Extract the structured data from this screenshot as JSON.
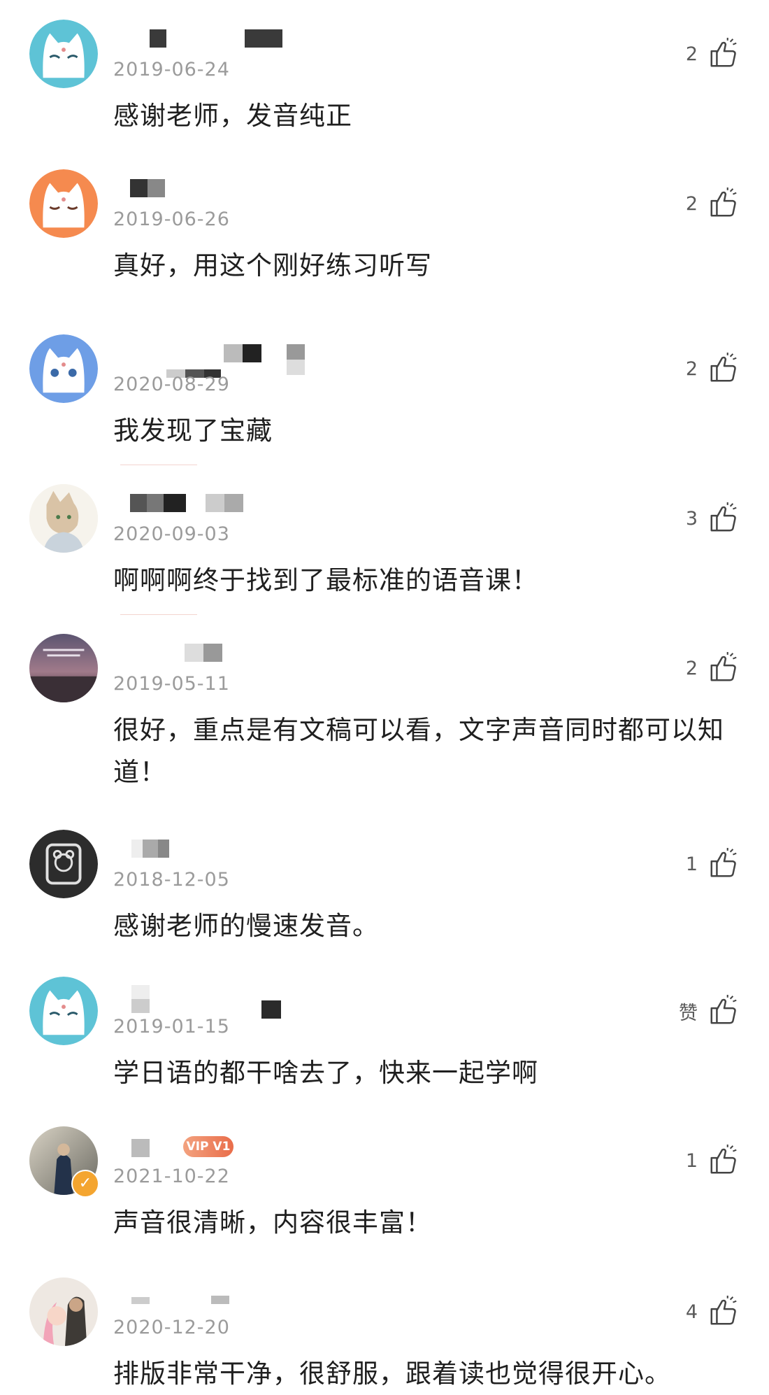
{
  "comments": [
    {
      "date": "2019-06-24",
      "text": "感谢老师，发音纯正",
      "likes": "2"
    },
    {
      "date": "2019-06-26",
      "text": "真好，用这个刚好练习听写",
      "likes": "2"
    },
    {
      "date": "2020-08-29",
      "text": "我发现了宝藏",
      "likes": "2"
    },
    {
      "date": "2020-09-03",
      "text": "啊啊啊终于找到了最标准的语音课！",
      "likes": "3"
    },
    {
      "date": "2019-05-11",
      "text": "很好，重点是有文稿可以看，文字声音同时都可以知道！",
      "likes": "2"
    },
    {
      "date": "2018-12-05",
      "text": "感谢老师的慢速发音。",
      "likes": "1"
    },
    {
      "date": "2019-01-15",
      "text": "学日语的都干啥去了，快来一起学啊",
      "likes": "赞"
    },
    {
      "date": "2021-10-22",
      "text": "声音很清晰，内容很丰富！",
      "likes": "1",
      "vip": "VIP V1"
    },
    {
      "date": "2020-12-20",
      "text": "排版非常干净，很舒服，跟着读也觉得很开心。",
      "likes": "4"
    }
  ],
  "icons": {
    "like": "thumbs-up-icon",
    "verified": "verified-badge-icon"
  },
  "colors": {
    "date": "#9b9b9b",
    "text": "#1f1f1f",
    "vip": "#e96d4a",
    "verified": "#f4a530"
  }
}
